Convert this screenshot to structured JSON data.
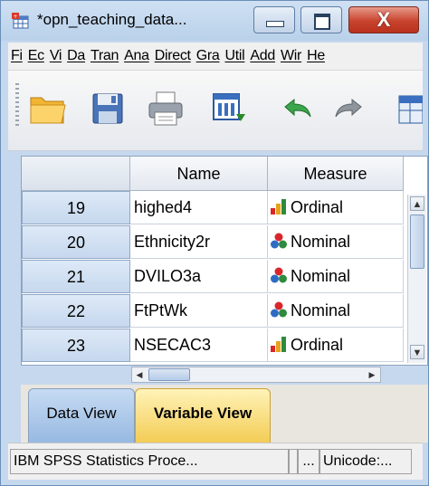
{
  "window": {
    "title": "*opn_teaching_data...",
    "close_label": "X"
  },
  "menu": [
    {
      "label": "Fi"
    },
    {
      "label": "Ec"
    },
    {
      "label": "Vi"
    },
    {
      "label": "Da"
    },
    {
      "label": "Tran"
    },
    {
      "label": "Ana"
    },
    {
      "label": "Direct"
    },
    {
      "label": "Gra"
    },
    {
      "label": "Util"
    },
    {
      "label": "Add"
    },
    {
      "label": "Wir"
    },
    {
      "label": "He"
    }
  ],
  "toolbar": {
    "icons": [
      "open-folder-icon",
      "save-icon",
      "print-icon",
      "dialog-recall-icon",
      "undo-icon",
      "redo-icon",
      "goto-case-icon"
    ]
  },
  "grid": {
    "columns": {
      "name": "Name",
      "measure": "Measure"
    },
    "rows": [
      {
        "num": "19",
        "name": "highed4",
        "measure": "Ordinal",
        "measure_icon": "ordinal-icon"
      },
      {
        "num": "20",
        "name": "Ethnicity2r",
        "measure": "Nominal",
        "measure_icon": "nominal-icon"
      },
      {
        "num": "21",
        "name": "DVILO3a",
        "measure": "Nominal",
        "measure_icon": "nominal-icon"
      },
      {
        "num": "22",
        "name": "FtPtWk",
        "measure": "Nominal",
        "measure_icon": "nominal-icon"
      },
      {
        "num": "23",
        "name": "NSECAC3",
        "measure": "Ordinal",
        "measure_icon": "ordinal-icon"
      }
    ]
  },
  "tabs": {
    "data_view": "Data View",
    "variable_view": "Variable View"
  },
  "status": {
    "processor": "IBM SPSS Statistics Proce...",
    "dots": "...",
    "unicode": "Unicode:..."
  },
  "colors": {
    "title_bar": "#b9d1ea",
    "active_tab": "#f3cc55",
    "close_button": "#c8432d"
  }
}
